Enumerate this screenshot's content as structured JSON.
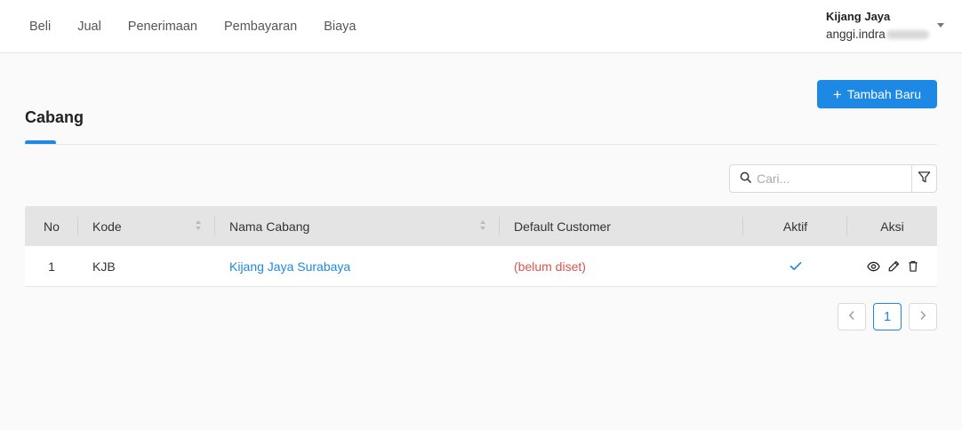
{
  "nav": [
    "Beli",
    "Jual",
    "Penerimaan",
    "Pembayaran",
    "Biaya"
  ],
  "user": {
    "company": "Kijang Jaya",
    "email": "anggi.indra"
  },
  "page": {
    "title": "Cabang",
    "add_button": "Tambah Baru"
  },
  "search": {
    "placeholder": "Cari..."
  },
  "table": {
    "headers": {
      "no": "No",
      "kode": "Kode",
      "nama": "Nama Cabang",
      "customer": "Default Customer",
      "aktif": "Aktif",
      "aksi": "Aksi"
    },
    "rows": [
      {
        "no": "1",
        "kode": "KJB",
        "nama": "Kijang Jaya Surabaya",
        "customer": "(belum diset)",
        "aktif": true
      }
    ]
  },
  "pagination": {
    "current": "1"
  },
  "colors": {
    "accent": "#1e88e5",
    "warning": "#d9534f",
    "header_bg": "#e4e4e4"
  },
  "icons": [
    "search-icon",
    "filter-icon",
    "check-icon",
    "view-icon",
    "edit-icon",
    "delete-icon",
    "chevron-left-icon",
    "chevron-right-icon",
    "caret-down-icon",
    "plus-icon"
  ]
}
